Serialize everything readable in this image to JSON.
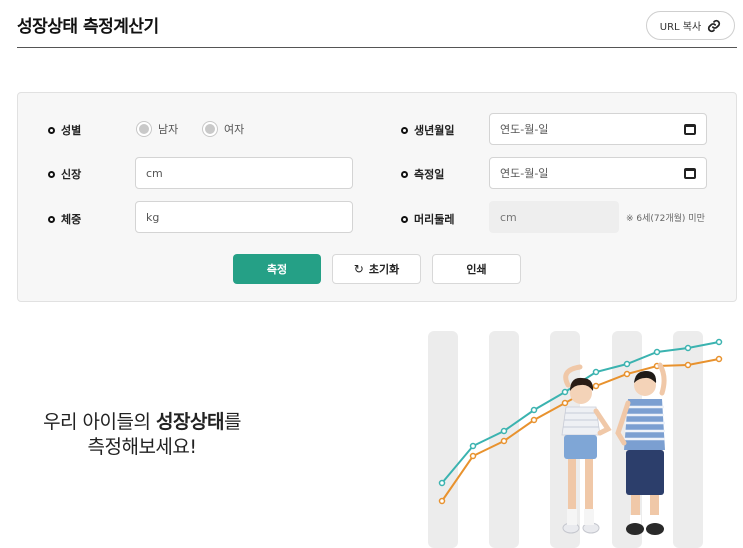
{
  "header": {
    "title": "성장상태 측정계산기",
    "url_copy_label": "URL 복사",
    "link_icon": "link-icon"
  },
  "form": {
    "gender": {
      "label": "성별",
      "options": [
        "남자",
        "여자"
      ]
    },
    "height": {
      "label": "신장",
      "placeholder": "cm"
    },
    "weight": {
      "label": "체중",
      "placeholder": "kg"
    },
    "birth_date": {
      "label": "생년월일",
      "placeholder": "연도-월-일"
    },
    "measure_date": {
      "label": "측정일",
      "placeholder": "연도-월-일"
    },
    "head_circ": {
      "label": "머리둘레",
      "placeholder": "cm",
      "note": "※ 6세(72개월) 미만"
    },
    "buttons": {
      "measure": "측정",
      "reset": "초기화",
      "print": "인쇄"
    }
  },
  "hero": {
    "line1_prefix": "우리 아이들의 ",
    "line1_bold": "성장상태",
    "line1_suffix": "를",
    "line2": "측정해보세요!"
  },
  "colors": {
    "accent": "#25a086",
    "teal_line": "#3bb3b0",
    "orange_line": "#e8922e"
  }
}
